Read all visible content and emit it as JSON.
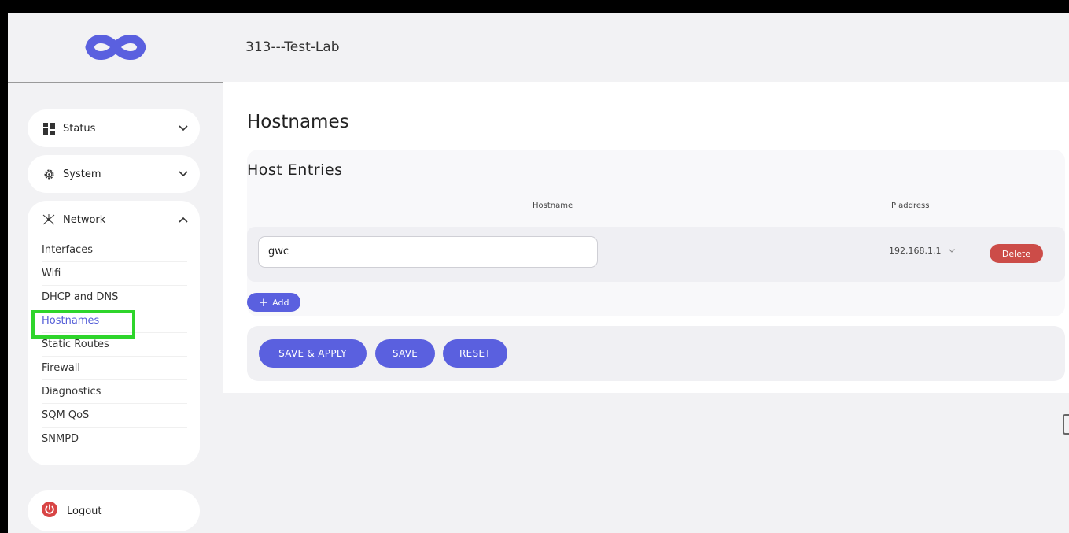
{
  "app": {
    "router_name": "313---Test-Lab",
    "brand_color": "#5a60df",
    "danger_color": "#cc4c48"
  },
  "sidebar": {
    "logo_icon": "infinity-logo",
    "sections": [
      {
        "label": "Status",
        "icon": "grid-icon",
        "expanded": false
      },
      {
        "label": "System",
        "icon": "gear-icon",
        "expanded": false
      },
      {
        "label": "Network",
        "icon": "network-icon",
        "expanded": true
      }
    ],
    "network_items": [
      {
        "label": "Interfaces"
      },
      {
        "label": "Wifi"
      },
      {
        "label": "DHCP and DNS"
      },
      {
        "label": "Hostnames",
        "active": true
      },
      {
        "label": "Static Routes"
      },
      {
        "label": "Firewall"
      },
      {
        "label": "Diagnostics"
      },
      {
        "label": "SQM QoS"
      },
      {
        "label": "SNMPD"
      }
    ],
    "logout_label": "Logout"
  },
  "main": {
    "page_title": "Hostnames",
    "section_title": "Host Entries",
    "columns": {
      "hostname": "Hostname",
      "ip": "IP address"
    },
    "rows": [
      {
        "hostname": "gwc",
        "ip": "192.168.1.1",
        "delete_label": "Delete"
      }
    ],
    "add_label": "Add",
    "actions": {
      "save_apply": "SAVE & APPLY",
      "save": "SAVE",
      "reset": "RESET"
    }
  }
}
